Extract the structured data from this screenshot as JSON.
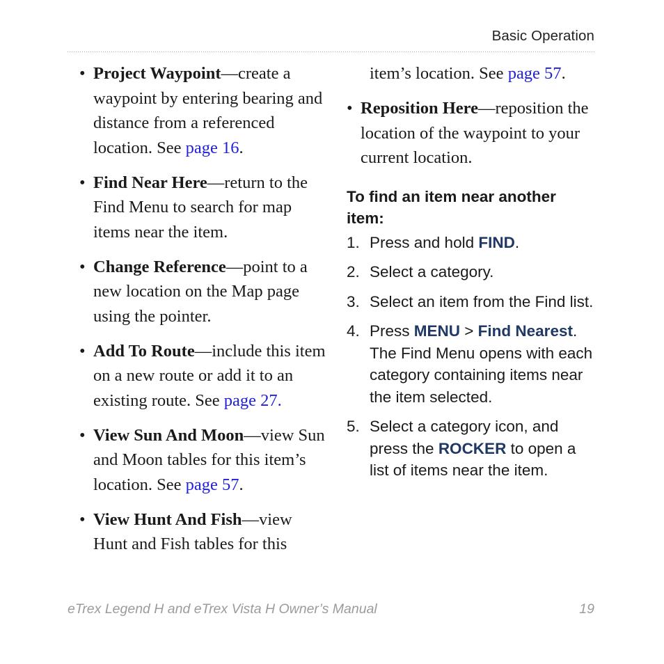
{
  "header": {
    "title": "Basic Operation"
  },
  "left_column": {
    "bullet_glyph": "•",
    "items": [
      {
        "term": "Project Waypoint",
        "dash": "—",
        "text_before_link": "create a waypoint by entering bearing and distance from a referenced location. See ",
        "link": "page 16",
        "text_after_link": "."
      },
      {
        "term": "Find Near Here",
        "dash": "—",
        "text_before_link": "return to the Find Menu to search for map items near the item.",
        "link": "",
        "text_after_link": ""
      },
      {
        "term": "Change Reference",
        "dash": "—",
        "text_before_link": "point to a new location on the Map page using the pointer.",
        "link": "",
        "text_after_link": ""
      },
      {
        "term": "Add To Route",
        "dash": "—",
        "text_before_link": "include this item on a new route or add it to an existing route. See ",
        "link": "page 27.",
        "text_after_link": ""
      },
      {
        "term": "View Sun And Moon",
        "dash": "—",
        "text_before_link": "view Sun and Moon tables for this item’s location. See ",
        "link": "page 57",
        "text_after_link": "."
      },
      {
        "term": "View Hunt And Fish",
        "dash": "—",
        "text_before_link": "view Hunt and Fish tables for this",
        "link": "",
        "text_after_link": ""
      }
    ]
  },
  "right_column": {
    "bullet_glyph": "•",
    "continuation": {
      "text_before_link": "item’s location. See ",
      "link": "page 57",
      "text_after_link": "."
    },
    "items": [
      {
        "term": "Reposition Here",
        "dash": "—",
        "text_before_link": "reposition the location of the waypoint to your current location.",
        "link": "",
        "text_after_link": ""
      }
    ],
    "procedure": {
      "heading": "To find an item near another item:",
      "steps": [
        {
          "number": "1.",
          "parts": [
            {
              "text": "Press and hold ",
              "style": "normal"
            },
            {
              "text": "FIND",
              "style": "key"
            },
            {
              "text": ".",
              "style": "normal"
            }
          ]
        },
        {
          "number": "2.",
          "parts": [
            {
              "text": "Select a category.",
              "style": "normal"
            }
          ]
        },
        {
          "number": "3.",
          "parts": [
            {
              "text": "Select an item from the Find list.",
              "style": "normal"
            }
          ]
        },
        {
          "number": "4.",
          "parts": [
            {
              "text": "Press ",
              "style": "normal"
            },
            {
              "text": "MENU",
              "style": "key"
            },
            {
              "text": " > ",
              "style": "normal"
            },
            {
              "text": "Find Nearest",
              "style": "key"
            },
            {
              "text": ". The Find Menu opens with each category containing items near the item selected.",
              "style": "normal"
            }
          ]
        },
        {
          "number": "5.",
          "parts": [
            {
              "text": "Select a category icon, and press the ",
              "style": "normal"
            },
            {
              "text": "ROCKER",
              "style": "key"
            },
            {
              "text": " to open a list of items near the item.",
              "style": "normal"
            }
          ]
        }
      ]
    }
  },
  "footer": {
    "manual_title": "eTrex Legend H and eTrex Vista H Owner’s Manual",
    "page_number": "19"
  },
  "colors": {
    "link_blue": "#2020dd",
    "key_navy": "#1f3864",
    "body_text": "#1a1a1a",
    "footer_gray": "#9b9b9b",
    "rule_gray": "#a9a9a9"
  }
}
